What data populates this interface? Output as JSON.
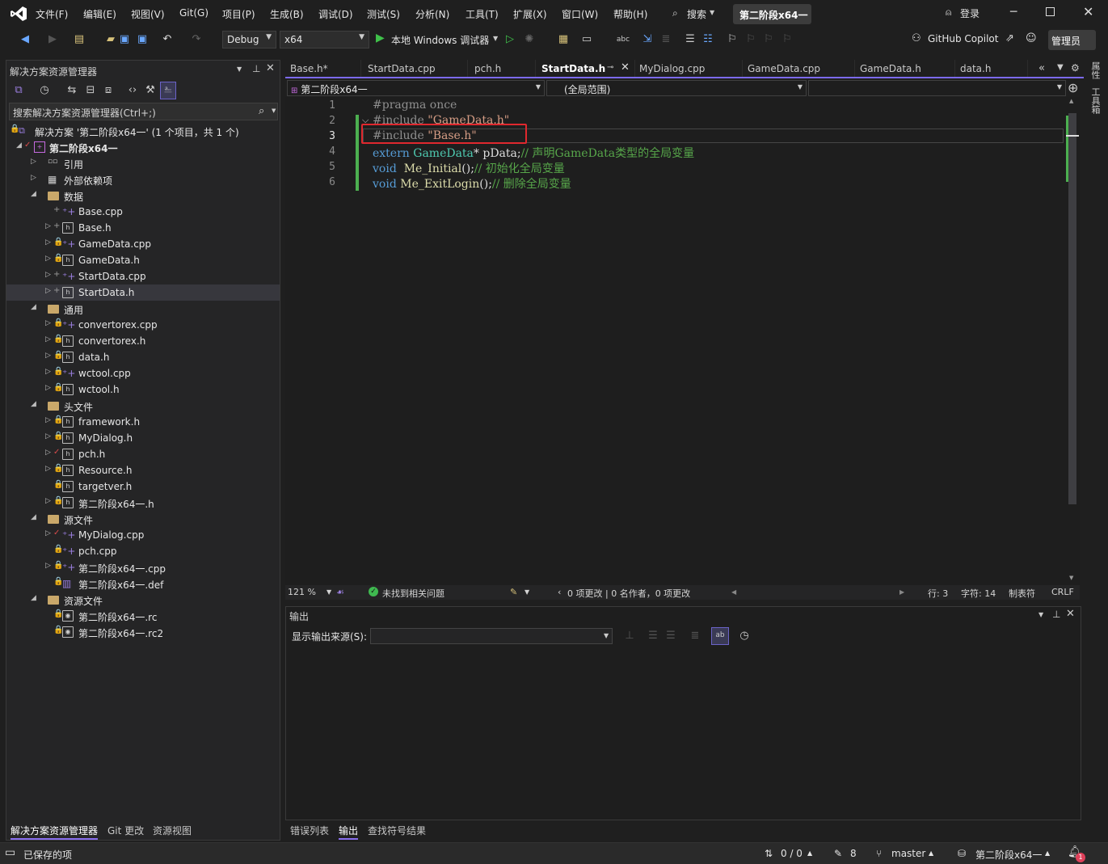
{
  "menu": [
    "文件(F)",
    "编辑(E)",
    "视图(V)",
    "Git(G)",
    "项目(P)",
    "生成(B)",
    "调试(D)",
    "测试(S)",
    "分析(N)",
    "工具(T)",
    "扩展(X)",
    "窗口(W)",
    "帮助(H)"
  ],
  "search_label": "搜索",
  "solution_name": "第二阶段x64一",
  "login_label": "登录",
  "toolbar": {
    "config": "Debug",
    "platform": "x64",
    "run_label": "本地 Windows 调试器",
    "copilot_label": "GitHub Copilot",
    "admin_label": "管理员"
  },
  "solution_explorer": {
    "title": "解决方案资源管理器",
    "search_placeholder": "搜索解决方案资源管理器(Ctrl+;)",
    "solution_row": "解决方案 '第二阶段x64一' (1 个项目，共 1 个)",
    "project": "第二阶段x64一",
    "items": [
      {
        "label": "引用",
        "kind": "ref",
        "level": 1,
        "arrow": "▷",
        "status": ""
      },
      {
        "label": "外部依赖项",
        "kind": "ext",
        "level": 1,
        "arrow": "▷",
        "status": ""
      },
      {
        "label": "数据",
        "kind": "folder",
        "level": 1,
        "arrow": "◢",
        "status": ""
      },
      {
        "label": "Base.cpp",
        "kind": "cpp",
        "level": 2,
        "arrow": "",
        "status": "+"
      },
      {
        "label": "Base.h",
        "kind": "h",
        "level": 2,
        "arrow": "▷",
        "status": "+"
      },
      {
        "label": "GameData.cpp",
        "kind": "cpp",
        "level": 2,
        "arrow": "▷",
        "status": "🔒"
      },
      {
        "label": "GameData.h",
        "kind": "h",
        "level": 2,
        "arrow": "▷",
        "status": "🔒"
      },
      {
        "label": "StartData.cpp",
        "kind": "cpp",
        "level": 2,
        "arrow": "▷",
        "status": "+"
      },
      {
        "label": "StartData.h",
        "kind": "h",
        "level": 2,
        "arrow": "▷",
        "status": "+"
      },
      {
        "label": "通用",
        "kind": "folder",
        "level": 1,
        "arrow": "◢",
        "status": ""
      },
      {
        "label": "convertorex.cpp",
        "kind": "cpp",
        "level": 2,
        "arrow": "▷",
        "status": "🔒"
      },
      {
        "label": "convertorex.h",
        "kind": "h",
        "level": 2,
        "arrow": "▷",
        "status": "🔒"
      },
      {
        "label": "data.h",
        "kind": "h",
        "level": 2,
        "arrow": "▷",
        "status": "🔒"
      },
      {
        "label": "wctool.cpp",
        "kind": "cpp",
        "level": 2,
        "arrow": "▷",
        "status": "🔒"
      },
      {
        "label": "wctool.h",
        "kind": "h",
        "level": 2,
        "arrow": "▷",
        "status": "🔒"
      },
      {
        "label": "头文件",
        "kind": "folder",
        "level": 1,
        "arrow": "◢",
        "status": ""
      },
      {
        "label": "framework.h",
        "kind": "h",
        "level": 2,
        "arrow": "▷",
        "status": "🔒"
      },
      {
        "label": "MyDialog.h",
        "kind": "h",
        "level": 2,
        "arrow": "▷",
        "status": "🔒"
      },
      {
        "label": "pch.h",
        "kind": "h",
        "level": 2,
        "arrow": "▷",
        "status": "✓"
      },
      {
        "label": "Resource.h",
        "kind": "h",
        "level": 2,
        "arrow": "▷",
        "status": "🔒"
      },
      {
        "label": "targetver.h",
        "kind": "h",
        "level": 2,
        "arrow": "",
        "status": "🔒"
      },
      {
        "label": "第二阶段x64一.h",
        "kind": "h",
        "level": 2,
        "arrow": "▷",
        "status": "🔒"
      },
      {
        "label": "源文件",
        "kind": "folder",
        "level": 1,
        "arrow": "◢",
        "status": ""
      },
      {
        "label": "MyDialog.cpp",
        "kind": "cpp",
        "level": 2,
        "arrow": "▷",
        "status": "✓"
      },
      {
        "label": "pch.cpp",
        "kind": "cpp",
        "level": 2,
        "arrow": "",
        "status": "🔒"
      },
      {
        "label": "第二阶段x64一.cpp",
        "kind": "cpp",
        "level": 2,
        "arrow": "▷",
        "status": "🔒"
      },
      {
        "label": "第二阶段x64一.def",
        "kind": "def",
        "level": 2,
        "arrow": "",
        "status": "🔒"
      },
      {
        "label": "资源文件",
        "kind": "folder",
        "level": 1,
        "arrow": "◢",
        "status": ""
      },
      {
        "label": "第二阶段x64一.rc",
        "kind": "rc",
        "level": 2,
        "arrow": "",
        "status": "🔒"
      },
      {
        "label": "第二阶段x64一.rc2",
        "kind": "rc",
        "level": 2,
        "arrow": "",
        "status": "🔒"
      }
    ],
    "selected_item": "StartData.h",
    "bottom_tabs": [
      "解决方案资源管理器",
      "Git 更改",
      "资源视图"
    ]
  },
  "editor": {
    "tabs": [
      "Base.h*",
      "StartData.cpp",
      "pch.h",
      "StartData.h",
      "MyDialog.cpp",
      "GameData.cpp",
      "GameData.h",
      "data.h"
    ],
    "active_tab": "StartData.h",
    "nav_project": "第二阶段x64一",
    "nav_scope": "(全局范围)",
    "line_numbers": [
      "1",
      "2",
      "3",
      "4",
      "5",
      "6"
    ],
    "current_line": "3",
    "code": {
      "l1": "#pragma once",
      "l2_pre": "#include ",
      "l2_str": "\"GameData.h\"",
      "l3_pre": "#include ",
      "l3_str": "\"Base.h\"",
      "l4_kw": "extern ",
      "l4_type": "GameData",
      "l4_rest": "* pData;",
      "l4_cm": "// 声明GameData类型的全局变量",
      "l5_kw": "void  ",
      "l5_fn": "Me_Initial",
      "l5_rest": "();",
      "l5_cm": "// 初始化全局变量",
      "l6_kw": "void ",
      "l6_fn": "Me_ExitLogin",
      "l6_rest": "();",
      "l6_cm": "// 删除全局变量"
    },
    "highlight_color": "#e0282e"
  },
  "editor_status": {
    "zoom": "121 %",
    "issues": "未找到相关问题",
    "changes": "0 项更改 | 0 名作者，0 项更改",
    "line": "行: 3",
    "col": "字符: 14",
    "indent": "制表符",
    "eol": "CRLF"
  },
  "output": {
    "title": "输出",
    "source_label": "显示输出来源(S):",
    "bottom_tabs": [
      "错误列表",
      "输出",
      "查找符号结果"
    ],
    "active_tab": "输出"
  },
  "right_rail": [
    "属性",
    "工具箱"
  ],
  "statusbar": {
    "saved": "已保存的项",
    "sync": "0 / 0",
    "edits": "8",
    "branch": "master",
    "repo": "第二阶段x64一",
    "notifications": "1"
  }
}
